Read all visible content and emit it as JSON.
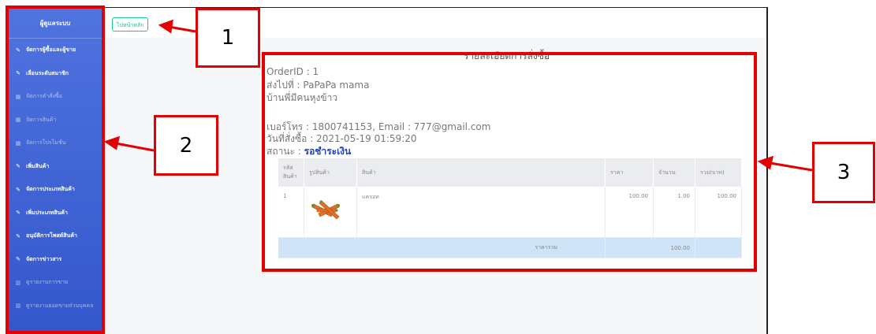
{
  "sidebar": {
    "brand": "ผู้ดูแลระบบ",
    "items": [
      {
        "label": "จัดการผู้ซื้อและผู้ขาย",
        "icon": "wrench-icon",
        "dim": false
      },
      {
        "label": "เลื่อนระดับสมาชิก",
        "icon": "wrench-icon",
        "dim": false
      },
      {
        "label": "จัดการคำสั่งซื้อ",
        "icon": "table-icon",
        "dim": true
      },
      {
        "label": "จัดการสินค้า",
        "icon": "table-icon",
        "dim": true
      },
      {
        "label": "จัดการโปรโมชั่น",
        "icon": "table-icon",
        "dim": true
      },
      {
        "label": "เพิ่มสินค้า",
        "icon": "wrench-icon",
        "dim": false
      },
      {
        "label": "จัดการประเภทสินค้า",
        "icon": "wrench-icon",
        "dim": false
      },
      {
        "label": "เพิ่มประเภทสินค้า",
        "icon": "wrench-icon",
        "dim": false
      },
      {
        "label": "อนุมัติการโพสต์สินค้า",
        "icon": "wrench-icon",
        "dim": false
      },
      {
        "label": "จัดการข่าวสาร",
        "icon": "wrench-icon",
        "dim": false
      },
      {
        "label": "ดูรายงานการขาย",
        "icon": "chart-icon",
        "dim": true
      },
      {
        "label": "ดูรายงานยอดขายส่วนบุคคล",
        "icon": "chart-icon",
        "dim": true
      }
    ]
  },
  "home_button": "ไปหน้าหลัก",
  "callouts": [
    "1",
    "2",
    "3"
  ],
  "order": {
    "title": "รายละเอียดการสั่งซื้อ",
    "order_id": "OrderID : 1",
    "ship_to": "ส่งไปที่ : PaPaPa mama",
    "address": "บ้านพี่มีคนหุงข้าว",
    "contact": "เบอร์โทร : 1800741153, Email : 777@gmail.com",
    "order_date": "วันที่สั่งซื้อ : 2021-05-19 01:59:20",
    "status_label": "สถานะ : ",
    "status_value": "รอชำระเงิน",
    "table": {
      "headers": [
        "รหัส สินค้า",
        "รูปสินค้า",
        "สินค้า",
        "ราคา",
        "จำนวน",
        "รวม(บาท)"
      ],
      "rows": [
        {
          "code": "1",
          "image": "carrot-image",
          "name": "แครอท",
          "price": "100.00",
          "qty": "1.00",
          "total": "100.00"
        }
      ],
      "total_label": "ราคารวม",
      "total_value": "100.00"
    }
  },
  "colors": {
    "sidebar": "#4e73df",
    "callout": "#e30000",
    "status": "#1f3fd0",
    "home_button": "#1cc88a"
  }
}
